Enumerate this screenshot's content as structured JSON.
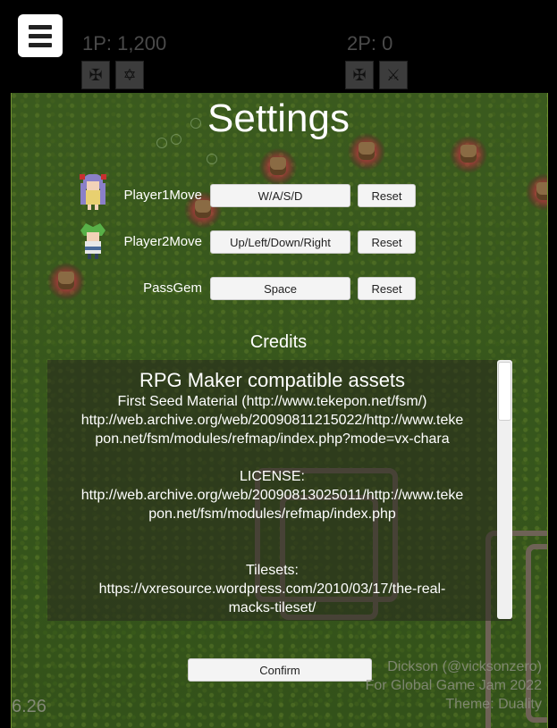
{
  "hud": {
    "p1_score": "1P: 1,200",
    "p2_score": "2P: 0",
    "menu_icon": "hamburger-menu-icon",
    "weapon_icons": [
      "pistol-icon",
      "rifle-icon",
      "pistol-icon",
      "sword-icon"
    ]
  },
  "settings": {
    "title": "Settings",
    "rows": [
      {
        "label": "Player1Move",
        "value": "W/A/S/D",
        "reset": "Reset"
      },
      {
        "label": "Player2Move",
        "value": "Up/Left/Down/Right",
        "reset": "Reset"
      },
      {
        "label": "PassGem",
        "value": "Space",
        "reset": "Reset"
      }
    ]
  },
  "credits": {
    "title": "Credits",
    "heading": "RPG Maker compatible assets",
    "lines": [
      "First Seed Material  (http://www.tekepon.net/fsm/)",
      "http://web.archive.org/web/20090811215022/http://www.teke",
      "pon.net/fsm/modules/refmap/index.php?mode=vx-chara",
      "LICENSE:",
      "http://web.archive.org/web/20090813025011/http://www.teke",
      "pon.net/fsm/modules/refmap/index.php",
      "Tilesets:",
      "https://vxresource.wordpress.com/2010/03/17/the-real-",
      "macks-tileset/"
    ]
  },
  "confirm_label": "Confirm",
  "background_credits": [
    "Dickson (@vicksonzero)",
    "For Global Game Jam 2022",
    "Theme: Duality"
  ],
  "version": "6.26",
  "colors": {
    "grass": "#3a5a1e",
    "enemy_glow": "#d22846",
    "button_bg": "#f4f4f4"
  }
}
